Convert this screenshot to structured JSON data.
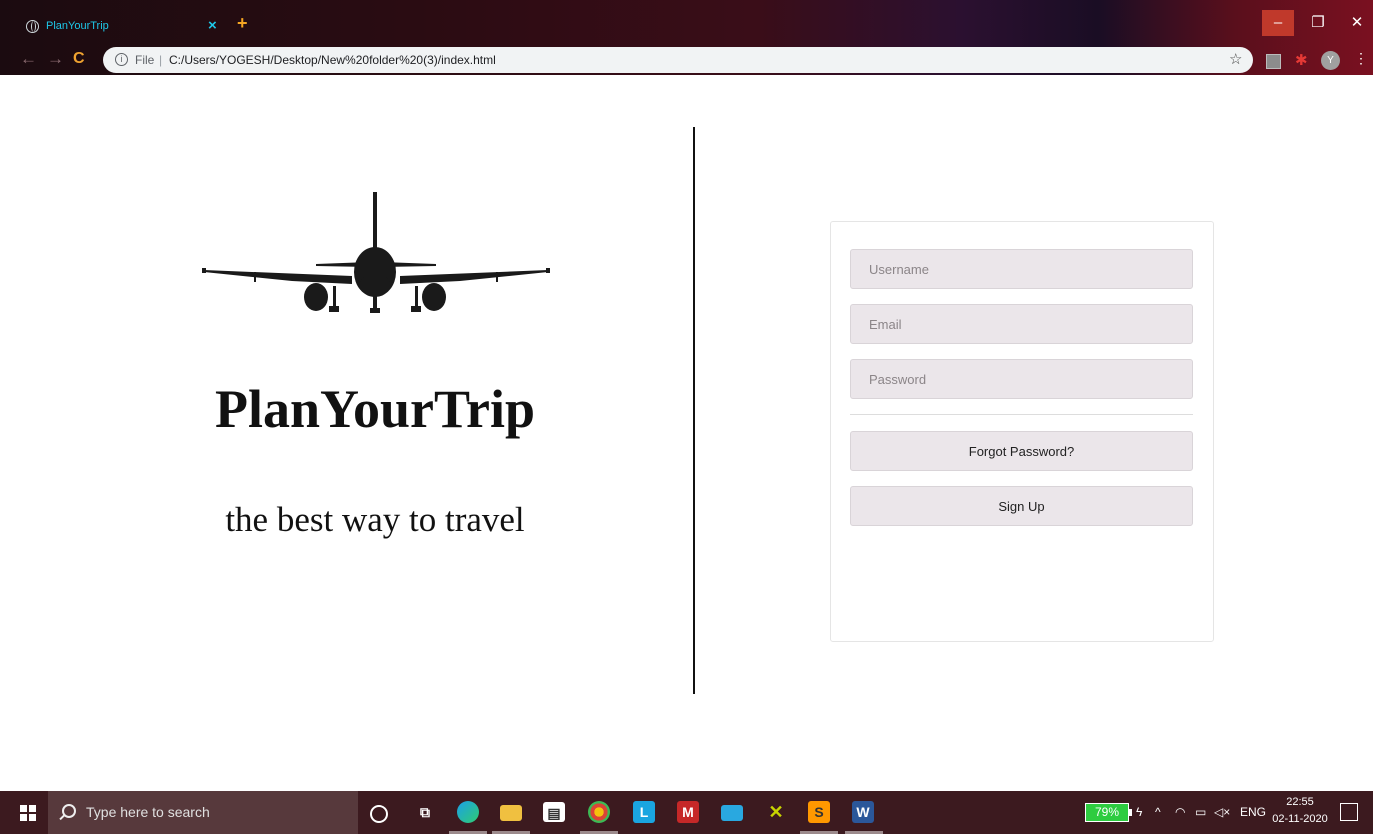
{
  "browser": {
    "tab_title": "PlanYourTrip",
    "tab_close": "×",
    "new_tab": "+",
    "address": {
      "scheme_label": "File",
      "url": "C:/Users/YOGESH/Desktop/New%20folder%20(3)/index.html"
    },
    "profile_initial": "Y"
  },
  "page": {
    "brand": "PlanYourTrip",
    "tagline": "the best way to travel",
    "form": {
      "username_placeholder": "Username",
      "email_placeholder": "Email",
      "password_placeholder": "Password",
      "forgot_label": "Forgot Password?",
      "signup_label": "Sign Up"
    }
  },
  "taskbar": {
    "search_placeholder": "Type here to search",
    "battery": "79%",
    "language": "ENG",
    "time": "22:55",
    "date": "02-11-2020"
  },
  "colors": {
    "input_bg": "#ebe6ea",
    "tab_title": "#1ec8e8",
    "taskbar_bg": "#3c1a1f"
  }
}
